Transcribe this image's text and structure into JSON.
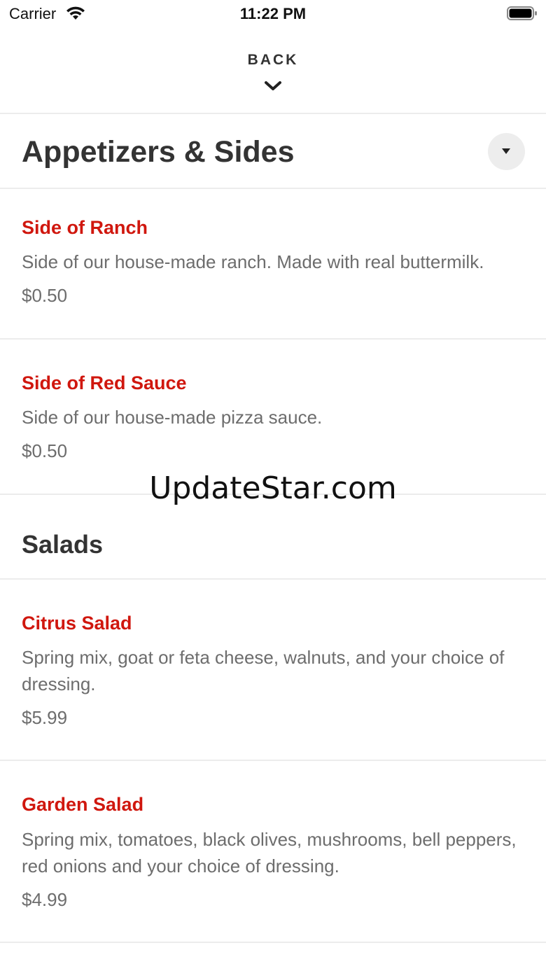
{
  "status_bar": {
    "carrier": "Carrier",
    "time": "11:22 PM",
    "icons": [
      "wifi-icon",
      "battery-icon"
    ]
  },
  "header": {
    "back_label": "BACK",
    "back_icon": "chevron-down-icon"
  },
  "sections": [
    {
      "title": "Appetizers & Sides",
      "toggle_icon": "caret-down-icon",
      "items": [
        {
          "name": "Side of Ranch",
          "description": "Side of our house-made ranch. Made with real buttermilk.",
          "price": "$0.50"
        },
        {
          "name": "Side of Red Sauce",
          "description": "Side of our house-made pizza sauce.",
          "price": "$0.50"
        }
      ]
    },
    {
      "title": "Salads",
      "items": [
        {
          "name": "Citrus Salad",
          "description": "Spring mix, goat or feta cheese, walnuts, and your choice of dressing.",
          "price": "$5.99"
        },
        {
          "name": "Garden Salad",
          "description": "Spring mix, tomatoes, black olives, mushrooms, bell peppers, red onions and your choice of dressing.",
          "price": "$4.99"
        }
      ]
    }
  ],
  "watermark": "UpdateStar.com",
  "colors": {
    "item_name": "#d0170e",
    "body_text": "#6d6d6d",
    "heading": "#333333",
    "divider": "#ececec",
    "toggle_bg": "#ededed"
  }
}
